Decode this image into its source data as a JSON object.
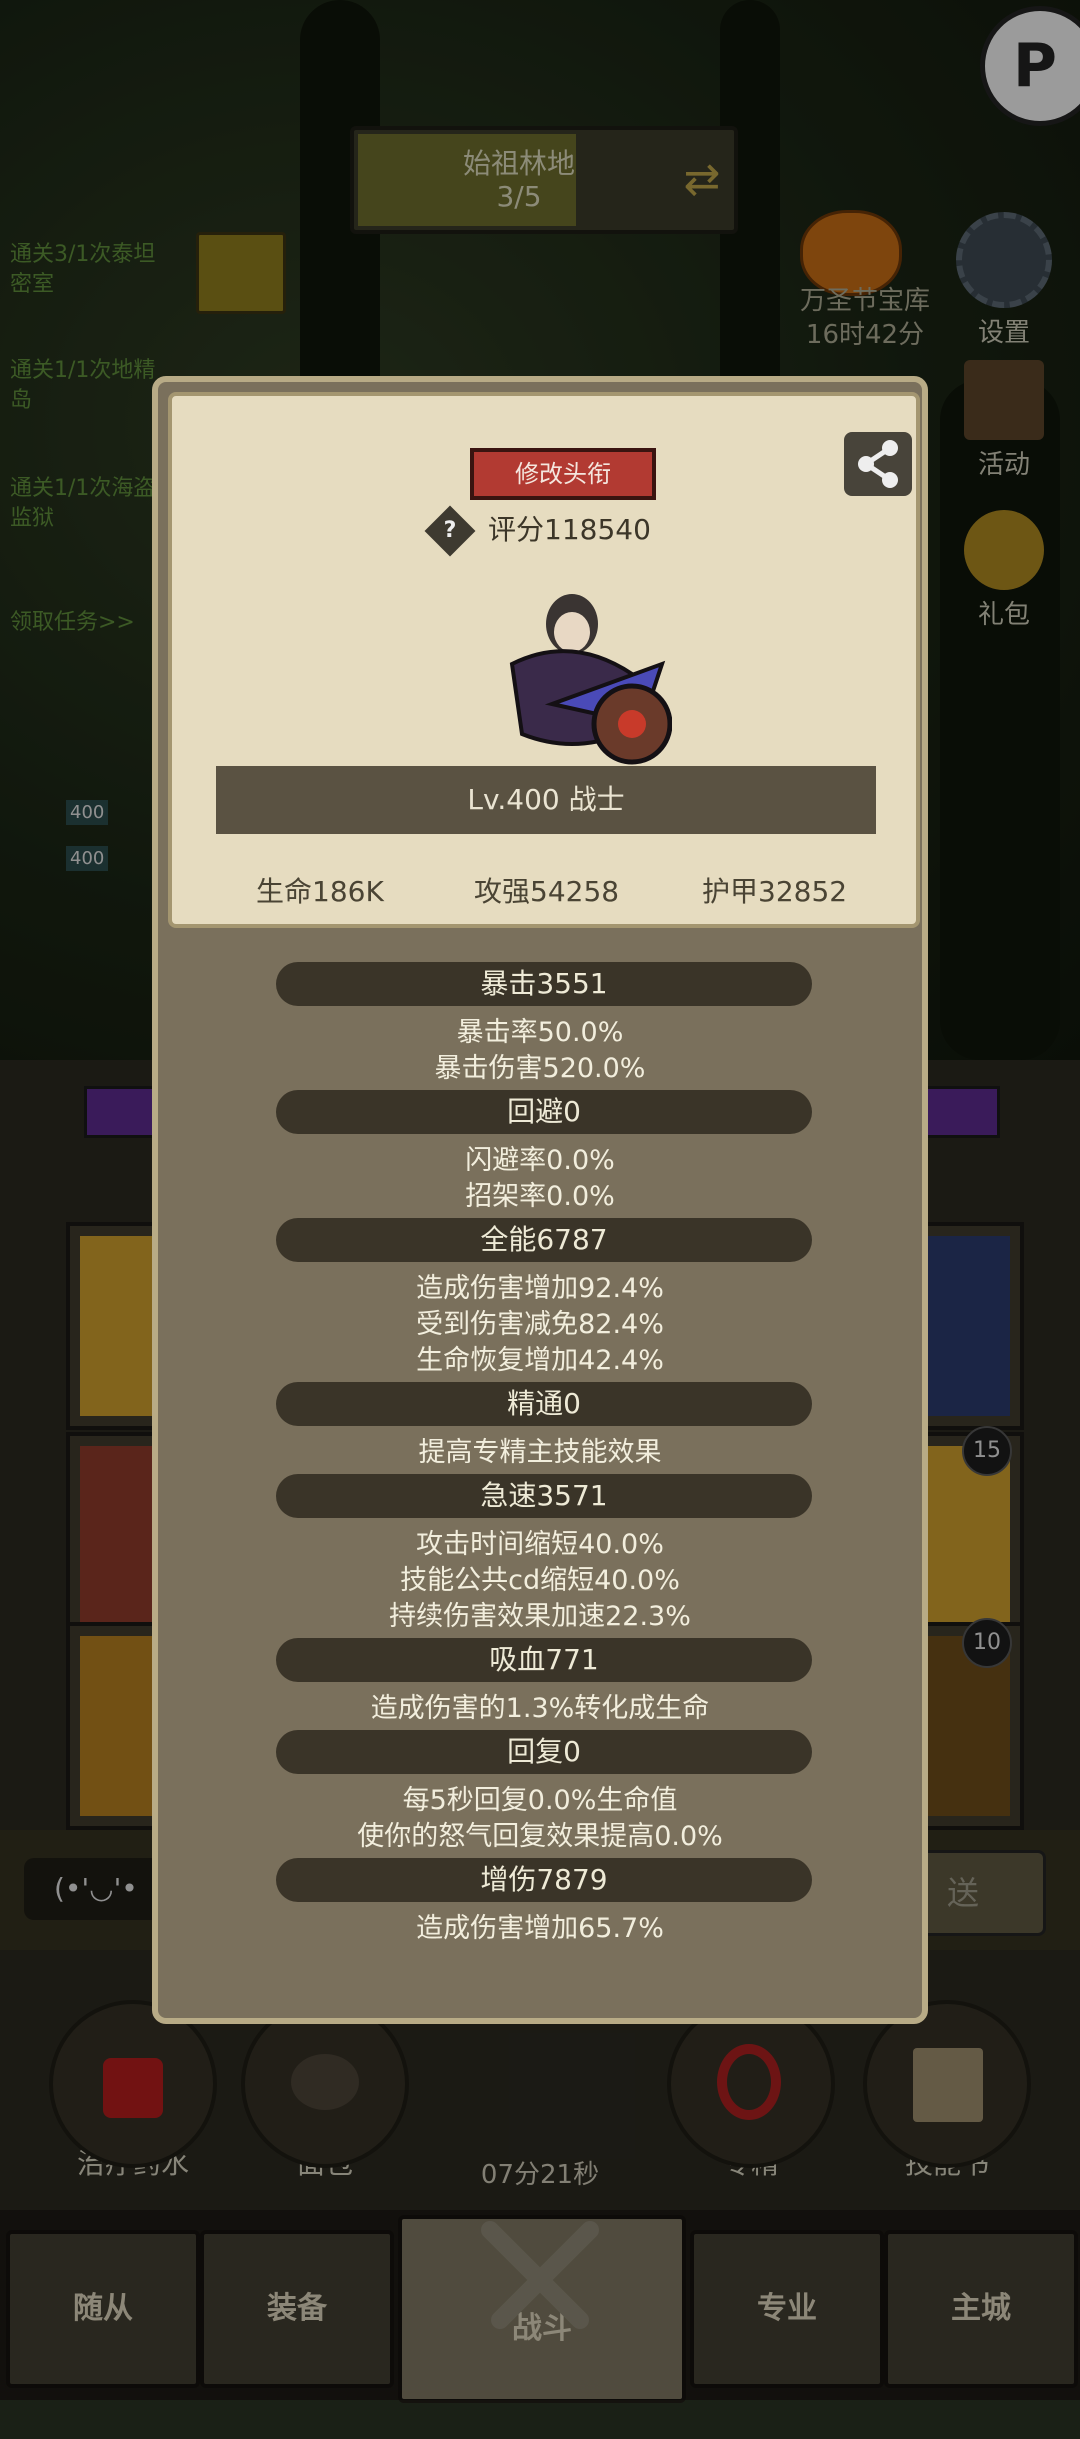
{
  "stage": {
    "name": "始祖林地",
    "progress": "3/5"
  },
  "quests": [
    {
      "text": "通关3/1次泰坦密室"
    },
    {
      "text": "通关1/1次地精岛"
    },
    {
      "text": "通关1/1次海盗监狱"
    }
  ],
  "quest_link": "领取任务>>",
  "event": {
    "name": "万圣节宝库",
    "timer": "16时42分"
  },
  "side_menu": [
    {
      "label": "设置",
      "icon": "gear-icon"
    },
    {
      "label": "活动",
      "icon": "calendar-icon"
    },
    {
      "label": "礼包",
      "icon": "gift-icon"
    }
  ],
  "hp_labels": [
    "400",
    "400"
  ],
  "card_badges": [
    "15",
    "10"
  ],
  "chat": {
    "emoticon": "(•'◡'•",
    "send_label": "发送",
    "send_visible": "送"
  },
  "items": [
    {
      "label": "治疗药水"
    },
    {
      "label": "面包"
    },
    {
      "label": "专精"
    },
    {
      "label": "技能书"
    }
  ],
  "chest_timer": "07分21秒",
  "tabs": [
    {
      "label": "随从"
    },
    {
      "label": "装备"
    },
    {
      "label": "战斗"
    },
    {
      "label": "专业"
    },
    {
      "label": "主城"
    }
  ],
  "profile": {
    "title_button": "修改头衔",
    "score": "评分118540",
    "level_class": "Lv.400 战士",
    "main_stats": [
      "生命186K",
      "攻强54258",
      "护甲32852"
    ]
  },
  "attributes": [
    {
      "head": "暴击3551",
      "lines": [
        "暴击率50.0%",
        "暴击伤害520.0%"
      ]
    },
    {
      "head": "回避0",
      "lines": [
        "闪避率0.0%",
        "招架率0.0%"
      ]
    },
    {
      "head": "全能6787",
      "lines": [
        "造成伤害增加92.4%",
        "受到伤害减免82.4%",
        "生命恢复增加42.4%"
      ]
    },
    {
      "head": "精通0",
      "lines": [
        "提高专精主技能效果"
      ]
    },
    {
      "head": "急速3571",
      "lines": [
        "攻击时间缩短40.0%",
        "技能公共cd缩短40.0%",
        "持续伤害效果加速22.3%"
      ]
    },
    {
      "head": "吸血771",
      "lines": [
        "造成伤害的1.3%转化成生命"
      ]
    },
    {
      "head": "回复0",
      "lines": [
        "每5秒回复0.0%生命值",
        "使你的怒气回复效果提高0.0%"
      ]
    },
    {
      "head": "增伤7879",
      "lines": [
        "造成伤害增加65.7%"
      ]
    }
  ],
  "colors": {
    "title_button": "#b23a32",
    "panel": "#7a705c",
    "card": "#e6dcc0"
  }
}
